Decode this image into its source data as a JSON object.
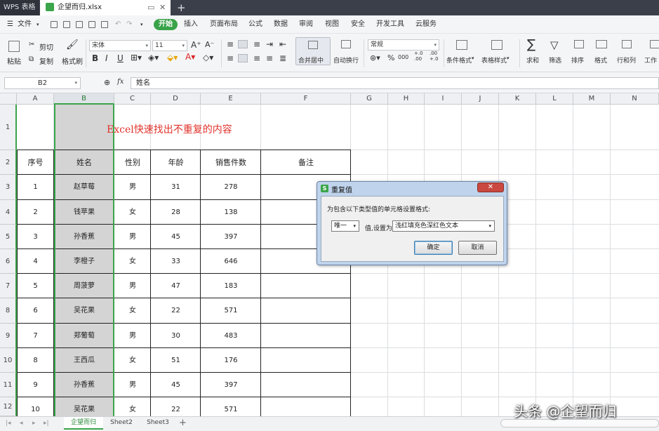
{
  "app": {
    "name": "WPS 表格",
    "file_name": "企望而归.xlsx",
    "new_tab": "+",
    "tab_controls": [
      "▭",
      "✕"
    ]
  },
  "menu": {
    "file": "文件",
    "items": [
      "开始",
      "插入",
      "页面布局",
      "公式",
      "数据",
      "审阅",
      "视图",
      "安全",
      "开发工具",
      "云服务"
    ]
  },
  "ribbon": {
    "paste": "粘贴",
    "cut": "剪切",
    "copy": "复制",
    "format_painter": "格式刷",
    "font_name": "宋体",
    "font_size": "11",
    "bold": "B",
    "italic": "I",
    "underline": "U",
    "merge_center": "合并居中",
    "wrap_text": "自动换行",
    "number_format": "常规",
    "percent": "%",
    "thousands": "000",
    "inc_decimal": "+.0 .00",
    "dec_decimal": ".00 +.0",
    "conditional_format": "条件格式",
    "table_style": "表格样式",
    "sum": "求和",
    "filter": "筛选",
    "sort": "排序",
    "format": "格式",
    "row_col": "行和列",
    "worksheet": "工作"
  },
  "formula_bar": {
    "cell_ref": "B2",
    "fx": "fx",
    "value": "姓名"
  },
  "columns": [
    "A",
    "B",
    "C",
    "D",
    "E",
    "F",
    "G",
    "H",
    "I",
    "J",
    "K",
    "L",
    "M",
    "N"
  ],
  "rows": [
    "1",
    "2",
    "3",
    "4",
    "5",
    "6",
    "7",
    "8",
    "9",
    "10",
    "11",
    "12"
  ],
  "sheet": {
    "title": "Excel快速找出不重复的内容",
    "headers": [
      "序号",
      "姓名",
      "性别",
      "年龄",
      "销售件数",
      "备注"
    ],
    "data": [
      [
        "1",
        "赵草莓",
        "男",
        "31",
        "278",
        ""
      ],
      [
        "2",
        "钱苹果",
        "女",
        "28",
        "138",
        ""
      ],
      [
        "3",
        "孙香蕉",
        "男",
        "45",
        "397",
        ""
      ],
      [
        "4",
        "李橙子",
        "女",
        "33",
        "646",
        ""
      ],
      [
        "5",
        "周菠萝",
        "男",
        "47",
        "183",
        ""
      ],
      [
        "6",
        "吴花果",
        "女",
        "22",
        "571",
        ""
      ],
      [
        "7",
        "郑葡萄",
        "男",
        "30",
        "483",
        ""
      ],
      [
        "8",
        "王西瓜",
        "女",
        "51",
        "176",
        ""
      ],
      [
        "9",
        "孙香蕉",
        "男",
        "45",
        "397",
        ""
      ],
      [
        "10",
        "吴花果",
        "女",
        "22",
        "571",
        ""
      ]
    ]
  },
  "dialog": {
    "title": "重复值",
    "close": "✕",
    "prompt": "为包含以下类型值的单元格设置格式:",
    "type_value": "唯一",
    "set_label": "值,设置为",
    "format_value": "浅红填充色深红色文本",
    "ok": "确定",
    "cancel": "取消"
  },
  "sheet_tabs": [
    "企望而归",
    "Sheet2",
    "Sheet3"
  ],
  "add_sheet": "+",
  "watermark": "头条 @企望而归",
  "colors": {
    "accent": "#3aa54a",
    "title_red": "#e0332c",
    "selected_col": "#d4d4d4"
  }
}
